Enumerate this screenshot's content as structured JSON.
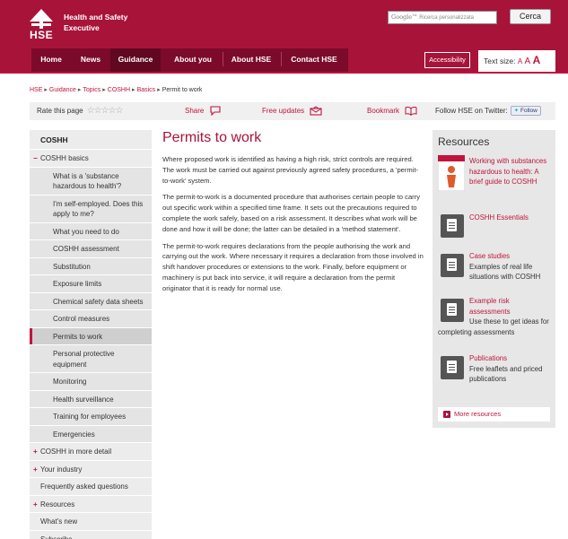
{
  "header": {
    "logo_abbr": "HSE",
    "logo_name_line1": "Health and Safety",
    "logo_name_line2": "Executive",
    "search_brand": "Google™",
    "search_placeholder": "Ricerca personalizzata",
    "search_button": "Cerca"
  },
  "nav": {
    "items": [
      "Home",
      "News",
      "Guidance",
      "About you",
      "About HSE",
      "Contact HSE"
    ],
    "active": "Guidance",
    "accessibility": "Accessibility",
    "text_size_label": "Text size:",
    "text_size_options": [
      "A",
      "A",
      "A"
    ]
  },
  "breadcrumb": {
    "items": [
      "HSE",
      "Guidance",
      "Topics",
      "COSHH",
      "Basics"
    ],
    "current": "Permit to work",
    "separator": "▸"
  },
  "share_bar": {
    "rate": "Rate this page",
    "stars": "☆☆☆☆☆",
    "share": "Share",
    "free_updates": "Free updates",
    "bookmark": "Bookmark",
    "follow": "Follow HSE on Twitter:",
    "follow_button": "Follow"
  },
  "sidebar": {
    "title": "COSHH",
    "items": [
      {
        "label": "COSHH basics",
        "level": 1,
        "marker": "−"
      },
      {
        "label": "What is a 'substance hazardous to health'?",
        "level": 2
      },
      {
        "label": "I'm self-employed. Does this apply to me?",
        "level": 2
      },
      {
        "label": "What you need to do",
        "level": 2
      },
      {
        "label": "COSHH assessment",
        "level": 2
      },
      {
        "label": "Substitution",
        "level": 2
      },
      {
        "label": "Exposure limits",
        "level": 2
      },
      {
        "label": "Chemical safety data sheets",
        "level": 2
      },
      {
        "label": "Control measures",
        "level": 2
      },
      {
        "label": "Permits to work",
        "level": 2,
        "current": true
      },
      {
        "label": "Personal protective equipment",
        "level": 2
      },
      {
        "label": "Monitoring",
        "level": 2
      },
      {
        "label": "Health surveillance",
        "level": 2
      },
      {
        "label": "Training for employees",
        "level": 2
      },
      {
        "label": "Emergencies",
        "level": 2
      },
      {
        "label": "COSHH in more detail",
        "level": 1,
        "marker": "+"
      },
      {
        "label": "Your industry",
        "level": 1,
        "marker": "+"
      },
      {
        "label": "Frequently asked questions",
        "level": 1
      },
      {
        "label": "Resources",
        "level": 1,
        "marker": "+"
      },
      {
        "label": "What's new",
        "level": 1
      },
      {
        "label": "Subscribe",
        "level": 1
      }
    ]
  },
  "main": {
    "title": "Permits to work",
    "paragraphs": [
      "Where proposed work is identified as having a high risk, strict controls are required. The work must be carried out against previously agreed safety procedures, a 'permit-to-work' system.",
      "The permit-to-work is a documented procedure that authorises certain people to carry out specific work within a specified time frame. It sets out the precautions required to complete the work safely,  based on a risk assessment. It describes what work will be done and how it will be done; the latter can be detailed in a 'method statement'.",
      "The permit-to-work requires declarations from the people authorising the work and carrying out the work. Where necessary it requires a declaration from those involved in shift handover procedures or extensions to the work. Finally, before equipment or machinery is put back into service, it will require a declaration from the permit originator that it is ready for normal use."
    ]
  },
  "resources": {
    "title": "Resources",
    "items": [
      {
        "link": "Working with substances hazardous to health: A brief guide to COSHH",
        "text": ""
      },
      {
        "link": "COSHH Essentials",
        "text": ""
      },
      {
        "link": "Case studies",
        "text": "Examples of real life situations with COSHH"
      },
      {
        "link": "Example risk assessments",
        "text": "Use these to get ideas for completing assessments"
      },
      {
        "link": "Publications",
        "text": "Free leaflets and priced publications"
      }
    ],
    "more": "More resources"
  },
  "colors": {
    "brand": "#a8133a",
    "link": "#c0143c"
  }
}
